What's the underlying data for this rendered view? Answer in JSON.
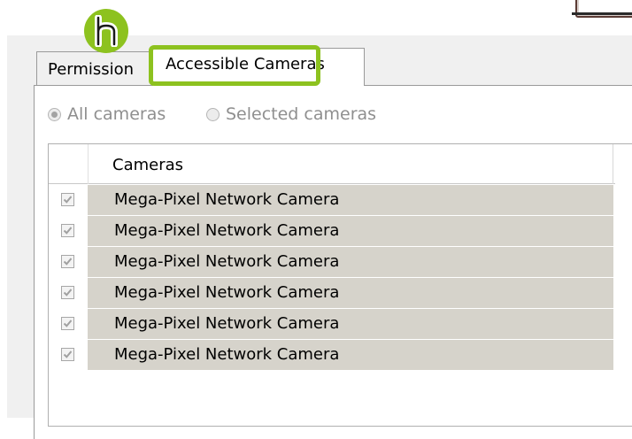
{
  "callout": {
    "letter": "h",
    "color": "#8dc21f"
  },
  "tabs": [
    {
      "label": "Permission",
      "active": false
    },
    {
      "label": "Accessible Cameras",
      "active": true
    }
  ],
  "scope": {
    "all_label": "All cameras",
    "selected_label": "Selected cameras",
    "selected_option": "all"
  },
  "grid": {
    "column_header": "Cameras",
    "row_fill": "#d6d3cb",
    "rows": [
      {
        "name": "Mega-Pixel Network Camera",
        "checked": true
      },
      {
        "name": "Mega-Pixel Network Camera",
        "checked": true
      },
      {
        "name": "Mega-Pixel Network Camera",
        "checked": true
      },
      {
        "name": "Mega-Pixel Network Camera",
        "checked": true
      },
      {
        "name": "Mega-Pixel Network Camera",
        "checked": true
      },
      {
        "name": "Mega-Pixel Network Camera",
        "checked": true
      }
    ]
  }
}
